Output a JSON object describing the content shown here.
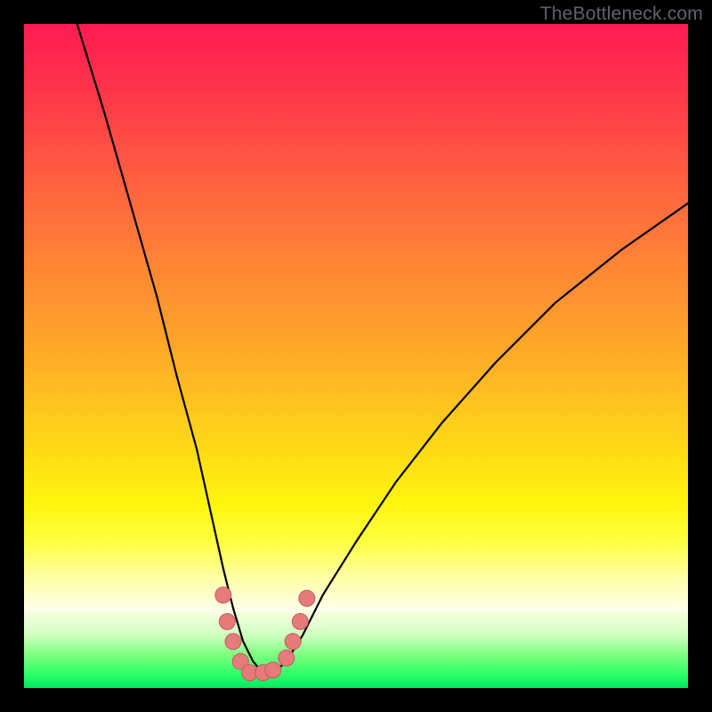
{
  "watermark": "TheBottleneck.com",
  "chart_data": {
    "type": "line",
    "title": "",
    "xlabel": "",
    "ylabel": "",
    "xlim": [
      0,
      100
    ],
    "ylim": [
      0,
      100
    ],
    "series": [
      {
        "name": "bottleneck-curve",
        "x": [
          8,
          12,
          16,
          20,
          23,
          26,
          28,
          30,
          31.5,
          33,
          34.5,
          36,
          37.5,
          39.5,
          42,
          45,
          50,
          56,
          63,
          71,
          80,
          90,
          100
        ],
        "y": [
          100,
          87,
          73,
          59,
          47,
          36,
          27,
          18,
          12,
          7,
          4,
          2.2,
          2.2,
          4,
          8,
          14,
          22,
          31,
          40,
          49,
          58,
          66,
          73
        ]
      }
    ],
    "markers": {
      "name": "highlight-points",
      "x": [
        30.0,
        30.6,
        31.5,
        32.6,
        34.0,
        36.0,
        37.5,
        39.5,
        40.5,
        41.6,
        42.6
      ],
      "y": [
        14.0,
        10.0,
        7.0,
        4.0,
        2.3,
        2.3,
        2.7,
        4.5,
        7.0,
        10.0,
        13.5
      ]
    },
    "gradient_stops": [
      {
        "pos": 0.0,
        "color": "#ff1b53"
      },
      {
        "pos": 0.28,
        "color": "#ff6d3c"
      },
      {
        "pos": 0.58,
        "color": "#ffc61e"
      },
      {
        "pos": 0.78,
        "color": "#ffff40"
      },
      {
        "pos": 0.9,
        "color": "#e8ffd0"
      },
      {
        "pos": 1.0,
        "color": "#00ea5e"
      }
    ]
  },
  "colors": {
    "curve": "#000000",
    "marker_fill": "#e77b7b",
    "marker_stroke": "#c45a5a",
    "frame": "#000000",
    "watermark": "#60636a"
  }
}
